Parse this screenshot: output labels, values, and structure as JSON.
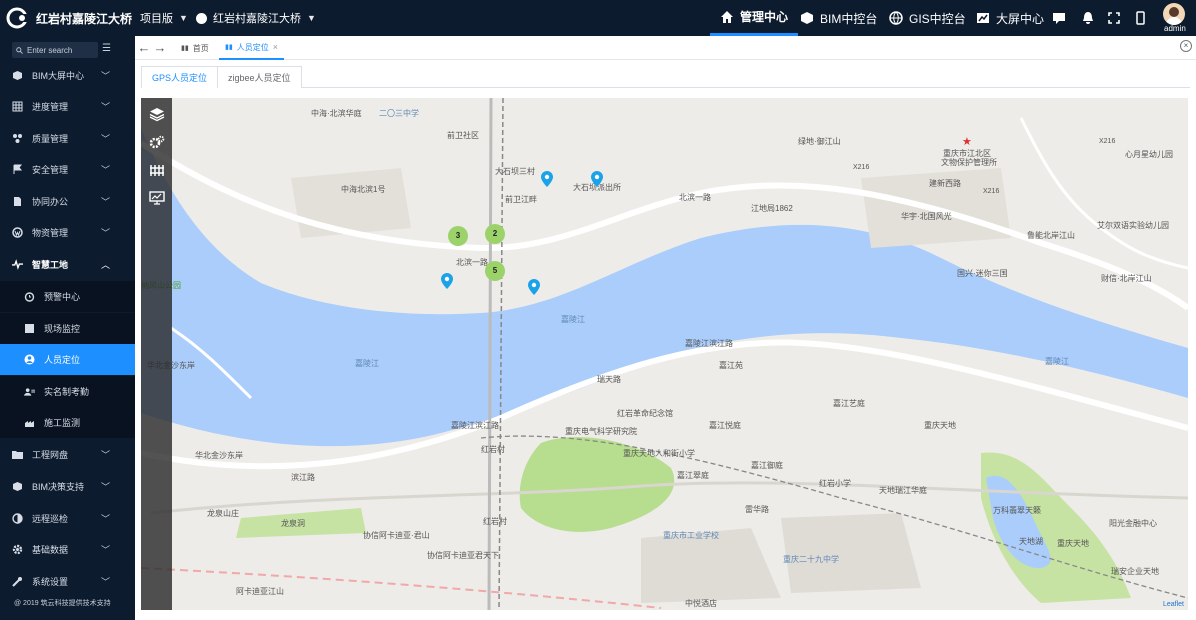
{
  "header": {
    "app_title": "红岩村嘉陵江大桥",
    "project_selector": "项目版",
    "site_selector": "红岩村嘉陵江大桥",
    "nav": [
      {
        "label": "管理中心",
        "icon": "home-icon",
        "active": true
      },
      {
        "label": "BIM中控台",
        "icon": "cube-icon",
        "active": false
      },
      {
        "label": "GIS中控台",
        "icon": "globe-icon",
        "active": false
      },
      {
        "label": "大屏中心",
        "icon": "chart-screen-icon",
        "active": false
      }
    ],
    "user": "admin"
  },
  "sidebar": {
    "search_placeholder": "Enter search",
    "items": [
      {
        "label": "BIM大屏中心",
        "icon": "cube-icon"
      },
      {
        "label": "进度管理",
        "icon": "grid-icon"
      },
      {
        "label": "质量管理",
        "icon": "tree-icon"
      },
      {
        "label": "安全管理",
        "icon": "flag-icon"
      },
      {
        "label": "协同办公",
        "icon": "document-icon"
      },
      {
        "label": "物资管理",
        "icon": "wordpress-icon"
      },
      {
        "label": "智慧工地",
        "icon": "pulse-icon",
        "expanded": true
      }
    ],
    "subitems": [
      {
        "label": "预警中心",
        "icon": "alarm-icon"
      },
      {
        "label": "现场监控",
        "icon": "monitor-icon"
      },
      {
        "label": "人员定位",
        "icon": "user-circle-icon",
        "active": true
      },
      {
        "label": "实名制考勤",
        "icon": "id-card-icon"
      },
      {
        "label": "施工监测",
        "icon": "gauge-icon"
      }
    ],
    "items2": [
      {
        "label": "工程网盘",
        "icon": "folder-icon"
      },
      {
        "label": "BIM决策支持",
        "icon": "cube-icon"
      },
      {
        "label": "远程巡检",
        "icon": "half-circle-icon"
      },
      {
        "label": "基础数据",
        "icon": "gear-icon"
      },
      {
        "label": "系统设置",
        "icon": "wrench-icon"
      }
    ],
    "footer": "@ 2019 筑云科技提供技术支持"
  },
  "page_tabs": [
    {
      "label": "首页",
      "active": false
    },
    {
      "label": "人员定位",
      "active": true
    }
  ],
  "sub_tabs": [
    {
      "label": "GPS人员定位",
      "active": true
    },
    {
      "label": "zigbee人员定位",
      "active": false
    }
  ],
  "map": {
    "clusters": [
      "3",
      "2",
      "5"
    ],
    "labels": {
      "l1": "中海·北滨华庭",
      "l2": "前卫社区",
      "l3": "二〇三中学",
      "l4": "大石坝三村",
      "l5": "大石坝派出所",
      "l6": "前卫江畔",
      "l7": "中海北滨1号",
      "l8": "北滨一路",
      "l9": "北滨一路",
      "l10": "江地局1862",
      "l11": "绿地·御江山",
      "l12": "重庆市江北区",
      "l13": "文物保护管理所",
      "l14": "心月星幼儿园",
      "l15": "建新西路",
      "l16": "华宇·北国风光",
      "l17": "鲁能北岸江山",
      "l18": "国兴·迷你三国",
      "l19": "艾尔双语实验幼儿园",
      "l20": "财信·北岸江山",
      "l21": "嘉陵江滨江路",
      "l22": "嘉陵江滨江路",
      "l23": "瑞天路",
      "l24": "红岩革命纪念馆",
      "l25": "重庆电气科学研究院",
      "l26": "重庆天地人和街小学",
      "l27": "嘉江苑",
      "l28": "嘉江艺庭",
      "l29": "嘉江悦庭",
      "l30": "嘉江御庭",
      "l31": "重庆天地",
      "l32": "嘉江翠庭",
      "l33": "红岩小学",
      "l34": "天地瑞江华庭",
      "l35": "万科翡翠天籁",
      "l36": "阳光金融中心",
      "l37": "红岩村",
      "l38": "红岩村",
      "l39": "华北金沙东岸",
      "l40": "华北金沙东岸",
      "l41": "龙泉山庄",
      "l42": "龙泉洞",
      "l43": "协信阿卡迪亚·君山",
      "l44": "协信阿卡迪亚君天下",
      "l45": "重庆市工业学校",
      "l46": "重庆二十九中学",
      "l47": "中悦酒店",
      "l48": "嘉陵江",
      "l49": "嘉陵江",
      "l50": "嘉陵江",
      "l51": "天地湖",
      "l52": "重庆天地",
      "l53": "瑞安企业天地",
      "l54": "雷华路",
      "l55": "阿卡迪亚江山",
      "l56": "纳凤山公园",
      "l57": "X216",
      "l58": "X216",
      "l59": "X216",
      "l60": "滨江路"
    },
    "attribution": "Leaflet"
  }
}
